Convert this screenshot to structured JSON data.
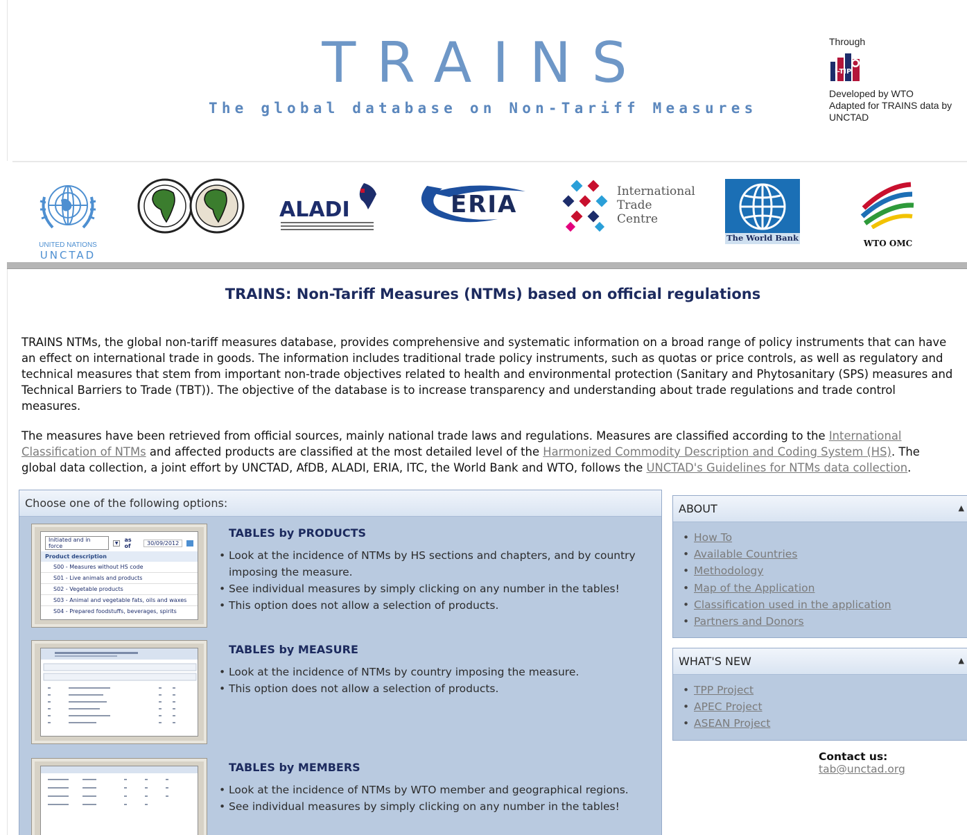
{
  "header": {
    "title": "TRAINS",
    "subtitle": "The global database on Non-Tariff Measures",
    "through": {
      "label": "Through",
      "logo_text": "I-TIP",
      "line1": "Developed by WTO",
      "line2": "Adapted for TRAINS data by UNCTAD"
    }
  },
  "partners": [
    {
      "name": "UNCTAD",
      "caption_top": "UNITED NATIONS",
      "caption_bottom": "UNCTAD"
    },
    {
      "name": "AfDB"
    },
    {
      "name": "ALADI",
      "text": "ALADI"
    },
    {
      "name": "ERIA",
      "text": "ERIA"
    },
    {
      "name": "ITC",
      "line1": "International",
      "line2": "Trade",
      "line3": "Centre"
    },
    {
      "name": "World Bank",
      "text": "The World Bank"
    },
    {
      "name": "WTO",
      "text": "WTO OMC"
    }
  ],
  "main": {
    "title": "TRAINS: Non-Tariff Measures (NTMs) based on official regulations",
    "para1": "TRAINS NTMs, the global non-tariff measures database, provides comprehensive and systematic information on a broad range of policy instruments that can have an effect on international trade in goods. The information includes traditional trade policy instruments, such as quotas or price controls, as well as regulatory and technical measures that stem from important non-trade objectives related to health and environmental protection (Sanitary and Phytosanitary (SPS) measures and Technical Barriers to Trade (TBT)). The objective of the database is to increase transparency and understanding about trade regulations and trade control measures.",
    "para2": {
      "t1": "The measures have been retrieved from official sources, mainly national trade laws and regulations. Measures are classified according to the ",
      "link1": "International Classification of NTMs",
      "t2": " and affected products are classified at the most detailed level of the ",
      "link2": "Harmonized Commodity Description and Coding System (HS)",
      "t3": ". The global data collection, a joint effort by UNCTAD, AfDB, ALADI, ERIA, ITC, the World Bank and WTO, follows the ",
      "link3": "UNCTAD's Guidelines for NTMs data collection",
      "t4": "."
    }
  },
  "options": {
    "heading": "Choose one of the following options:",
    "items": [
      {
        "title": "TABLES by PRODUCTS",
        "bullets": [
          "Look at the incidence of NTMs by HS sections and chapters, and by country imposing the measure.",
          "See individual measures by simply clicking on any number in the tables!",
          "This option does not allow a selection of products."
        ],
        "thumb": {
          "dropdown": "Initiated and in force",
          "as_of_label": "as of",
          "date": "30/09/2012",
          "col_header": "Product description",
          "rows": [
            "S00 - Measures without HS code",
            "S01 - Live animals and products",
            "S02 - Vegetable products",
            "S03 - Animal and vegetable fats, oils and waxes",
            "S04 - Prepared foodstuffs, beverages, spirits"
          ]
        }
      },
      {
        "title": "TABLES by MEASURE",
        "bullets": [
          "Look at the incidence of NTMs by country imposing the measure.",
          "This option does not allow a selection of products."
        ]
      },
      {
        "title": "TABLES by MEMBERS",
        "bullets": [
          "Look at the incidence of NTMs by WTO member and geographical regions.",
          "See individual measures by simply clicking on any number in the tables!"
        ]
      }
    ]
  },
  "about": {
    "heading": "ABOUT",
    "links": [
      "How To",
      "Available Countries",
      "Methodology",
      "Map of the Application",
      "Classification used in the application",
      "Partners and Donors"
    ]
  },
  "whats_new": {
    "heading": "WHAT'S NEW",
    "links": [
      "TPP Project",
      "APEC Project",
      "ASEAN Project"
    ]
  },
  "contact": {
    "label": "Contact us:",
    "email": "tab@unctad.org"
  },
  "colors": {
    "title_blue": "#6e97c7",
    "heading_navy": "#1c2a5e",
    "panel_blue": "#b9cae0",
    "link_gray": "#7b7b7b"
  }
}
